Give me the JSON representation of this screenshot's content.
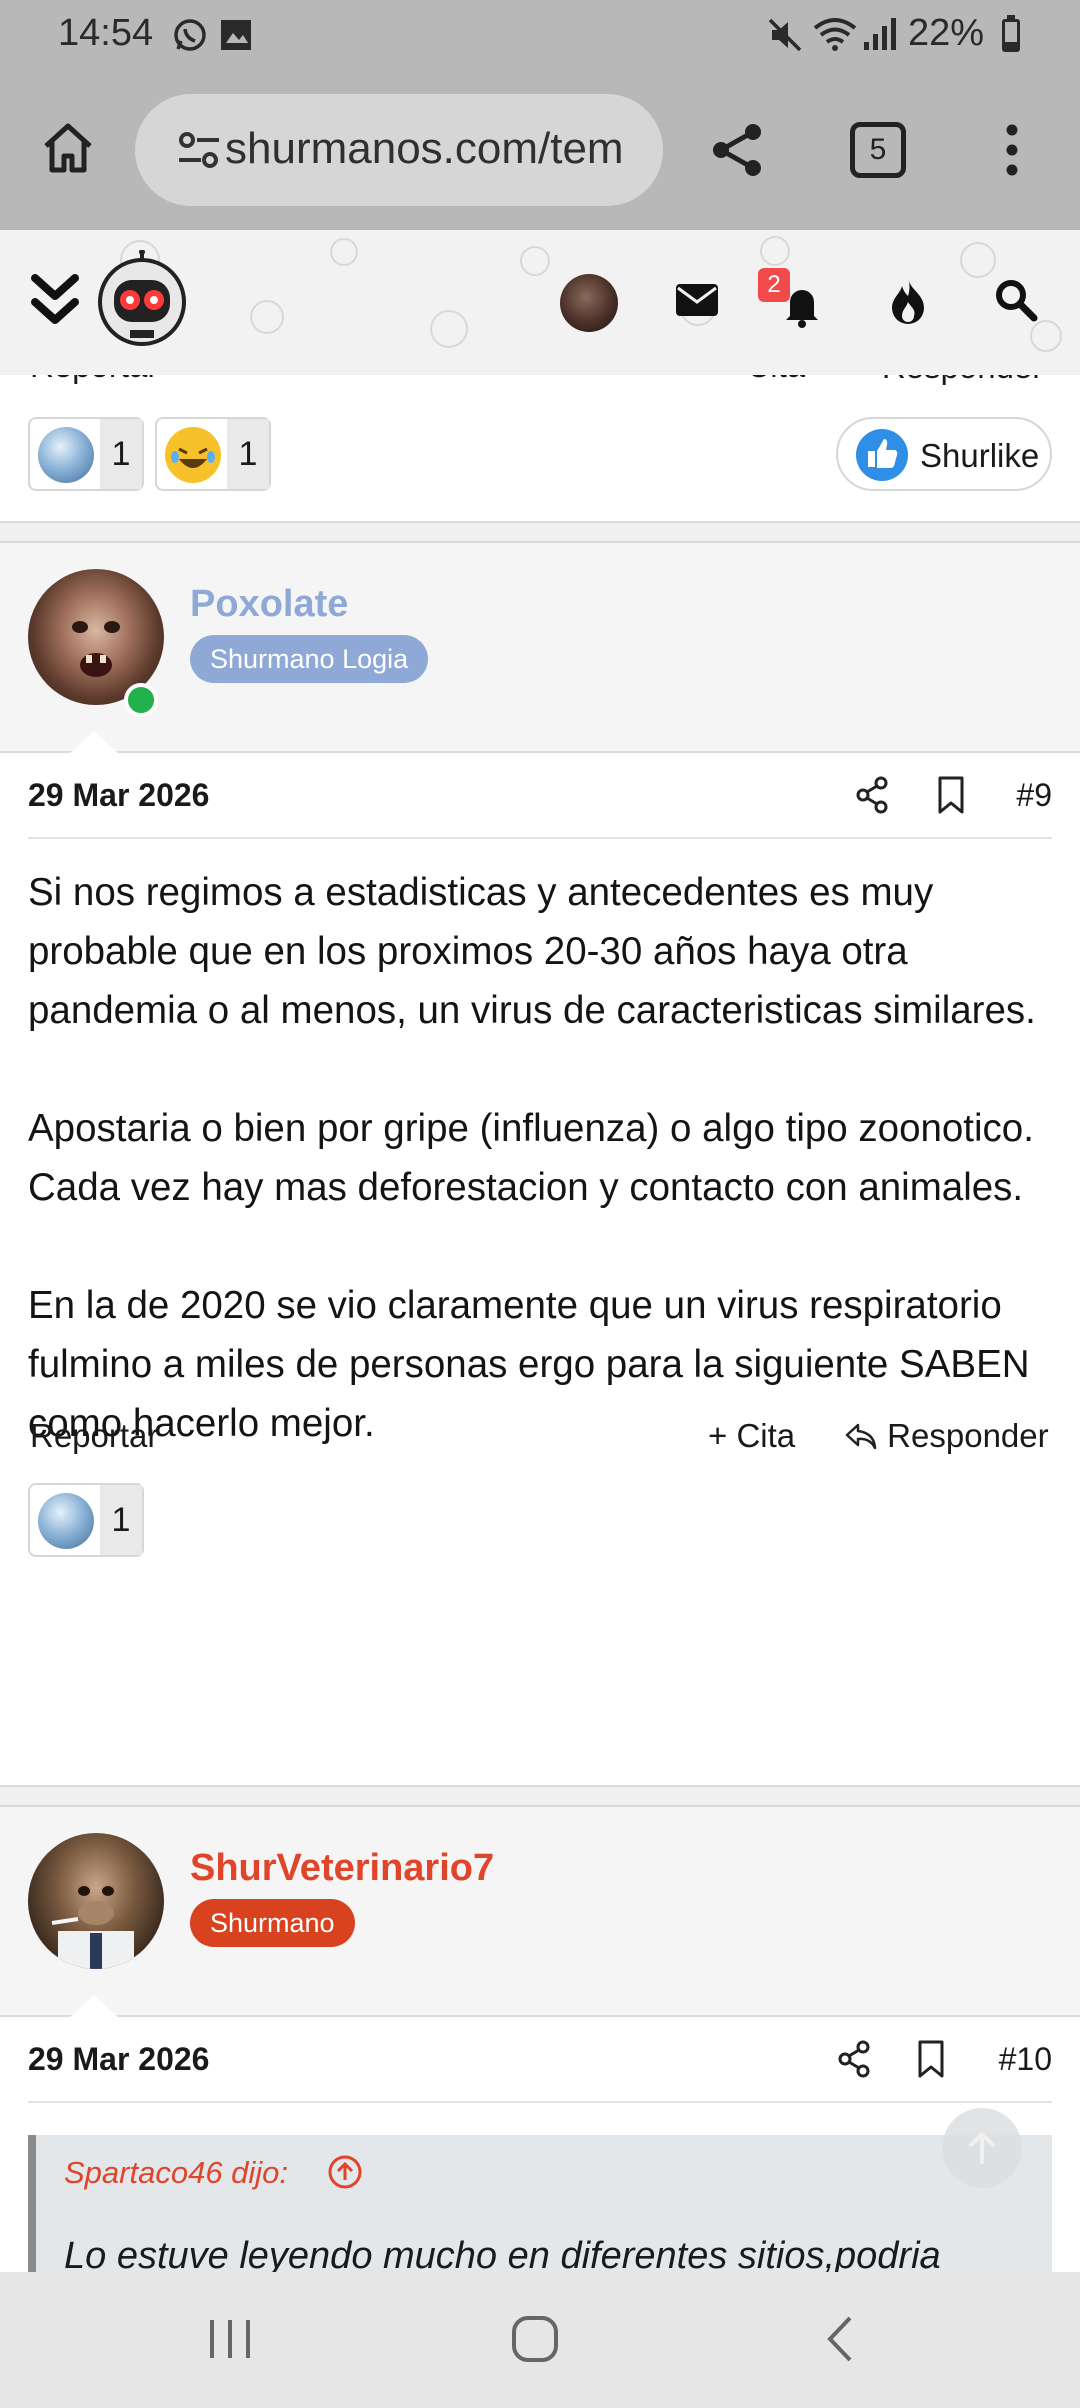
{
  "status_bar": {
    "time": "14:54",
    "battery": "22%",
    "icons": [
      "whatsapp-icon",
      "gallery-icon",
      "mute-icon",
      "wifi-icon",
      "signal-icon",
      "battery-icon"
    ]
  },
  "browser": {
    "url": "shurmanos.com/tem",
    "tab_count": "5",
    "icons": [
      "home-icon",
      "site-settings-icon",
      "share-icon",
      "tabs-icon",
      "more-icon"
    ]
  },
  "site_header": {
    "notification_count": "2",
    "icons": [
      "collapse-icon",
      "logo-robot",
      "user-avatar",
      "mail-icon",
      "bell-icon",
      "fire-icon",
      "search-icon"
    ]
  },
  "prev_post": {
    "report_label": "Reportar",
    "quote_label": "Cita",
    "reply_label": "Responder",
    "reactions": [
      {
        "icon": "diamond-icon",
        "count": "1"
      },
      {
        "icon": "laughing-emoji-icon",
        "count": "1"
      }
    ],
    "like_label": "Shurlike"
  },
  "post9": {
    "username": "Poxolate",
    "role": "Shurmano Logia",
    "date": "29 Mar 2026",
    "number": "#9",
    "body": "Si nos regimos a estadisticas y antecedentes es muy probable que en los proximos 20-30 años haya otra pandemia o al menos, un virus de caracteristicas similares.\n\nApostaria o bien por gripe (influenza) o algo tipo zoonotico. Cada vez hay mas deforestacion y contacto con animales.\n\nEn la de 2020 se vio claramente que un virus respiratorio fulmino a miles de personas ergo para la siguiente SABEN como hacerlo mejor.",
    "report_label": "Reportar",
    "quote_label": "Cita",
    "reply_label": "Responder",
    "reactions": [
      {
        "icon": "diamond-icon",
        "count": "1"
      }
    ]
  },
  "post10": {
    "username": "ShurVeterinario7",
    "role": "Shurmano",
    "date": "29 Mar 2026",
    "number": "#10",
    "quote_author": "Spartaco46 dijo:",
    "quote_text": "Lo estuve leyendo mucho en diferentes sitios,podria"
  },
  "colors": {
    "poxolate_name": "#8fa9d6",
    "logia_badge": "#8fa9d6",
    "vet_name": "#e0442a",
    "shurmano_badge": "#d8421e",
    "online": "#22b14c",
    "quote_author": "#e0442a",
    "notif_badge": "#f04a4a"
  }
}
